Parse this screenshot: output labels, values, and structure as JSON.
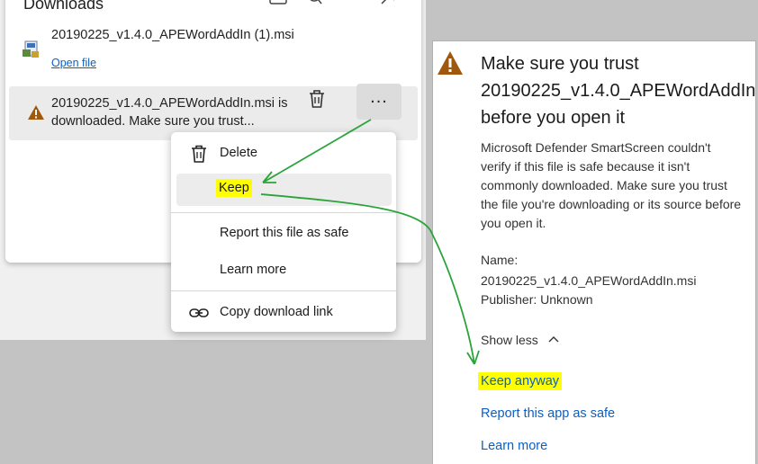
{
  "downloads": {
    "title": "Downloads",
    "items": [
      {
        "name": "20190225_v1.4.0_APEWordAddIn (1).msi",
        "action": "Open file"
      },
      {
        "line1": "20190225_v1.4.0_APEWordAddIn.msi is",
        "line2": "downloaded. Make sure you trust..."
      }
    ],
    "more_label": "..."
  },
  "menu": {
    "items": [
      "Delete",
      "Keep",
      "Report this file as safe",
      "Learn more",
      "Copy download link"
    ]
  },
  "dialog": {
    "title": "Make sure you trust\n20190225_v1.4.0_APEWordAddIn\nbefore you open it",
    "body": "Microsoft Defender SmartScreen couldn't verify if this file is safe because it isn't commonly downloaded. Make sure you trust the file you're downloading or its source before you open it.",
    "name_label": "Name:",
    "name_value": "20190225_v1.4.0_APEWordAddIn.msi",
    "publisher": "Publisher: Unknown",
    "show_less": "Show less",
    "keep_anyway": "Keep anyway",
    "report": "Report this app as safe",
    "learn_more": "Learn more"
  },
  "colors": {
    "highlight": "#ffff00",
    "arrow": "#2aa43a",
    "link": "#0b5fc4",
    "warning": "#a0580f"
  }
}
